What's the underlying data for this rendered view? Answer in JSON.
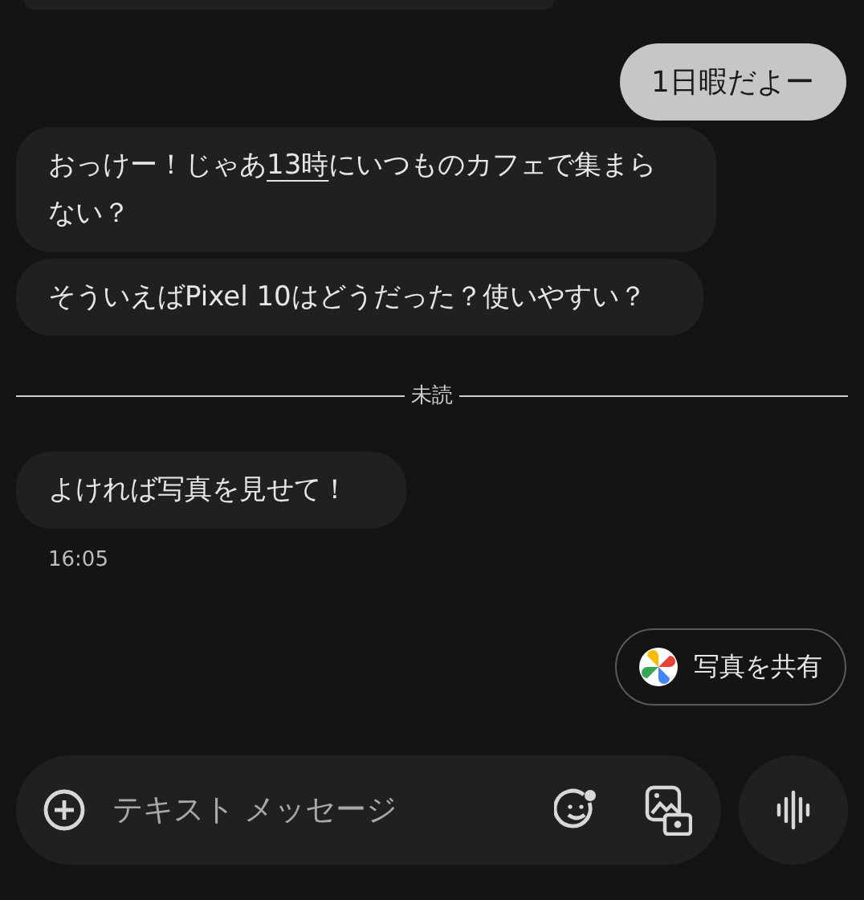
{
  "conversation": [
    {
      "kind": "partial"
    },
    {
      "kind": "sent",
      "segments": [
        {
          "text": "1日暇だよー",
          "kind": "text"
        }
      ]
    },
    {
      "kind": "received",
      "segments": [
        {
          "text": "おっけー！じゃあ",
          "kind": "text"
        },
        {
          "text": "13時",
          "kind": "link"
        },
        {
          "text": "にいつものカフェで集まらない？",
          "kind": "text"
        }
      ]
    },
    {
      "kind": "received",
      "segments": [
        {
          "text": "そういえばPixel 10はどうだった？使いやすい？",
          "kind": "text"
        }
      ]
    },
    {
      "kind": "divider",
      "label": "未読"
    },
    {
      "kind": "received",
      "segments": [
        {
          "text": "よければ写真を見せて！",
          "kind": "text"
        }
      ]
    },
    {
      "kind": "timestamp",
      "label": "16:05"
    }
  ],
  "suggestion": {
    "label": "写真を共有"
  },
  "composer": {
    "placeholder": "テキスト メッセージ"
  }
}
